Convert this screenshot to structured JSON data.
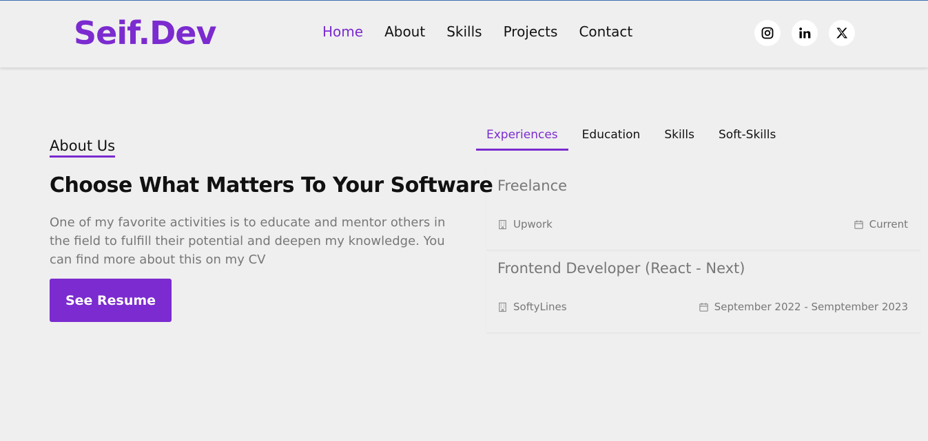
{
  "header": {
    "logo": "Seif.Dev",
    "nav": [
      {
        "label": "Home",
        "active": true
      },
      {
        "label": "About",
        "active": false
      },
      {
        "label": "Skills",
        "active": false
      },
      {
        "label": "Projects",
        "active": false
      },
      {
        "label": "Contact",
        "active": false
      }
    ],
    "socials": [
      {
        "icon": "instagram-icon"
      },
      {
        "icon": "linkedin-icon"
      },
      {
        "icon": "x-twitter-icon"
      }
    ]
  },
  "about": {
    "label": "About Us",
    "headline": "Choose What Matters To Your Software",
    "description": "One of my favorite activities is to educate and mentor others in the field to fulfill their potential and deepen my knowledge. You can find more about this on my CV",
    "button": "See Resume"
  },
  "tabs": [
    {
      "label": "Experiences",
      "active": true
    },
    {
      "label": "Education",
      "active": false
    },
    {
      "label": "Skills",
      "active": false
    },
    {
      "label": "Soft-Skills",
      "active": false
    }
  ],
  "experiences": [
    {
      "title": "Freelance",
      "company": "Upwork",
      "period": "Current"
    },
    {
      "title": "Frontend Developer (React - Next)",
      "company": "SoftyLines",
      "period": "September 2022 - Semptember 2023"
    }
  ],
  "colors": {
    "accent": "#7b2bcf",
    "background": "#efefef",
    "muted_text": "#777777"
  }
}
